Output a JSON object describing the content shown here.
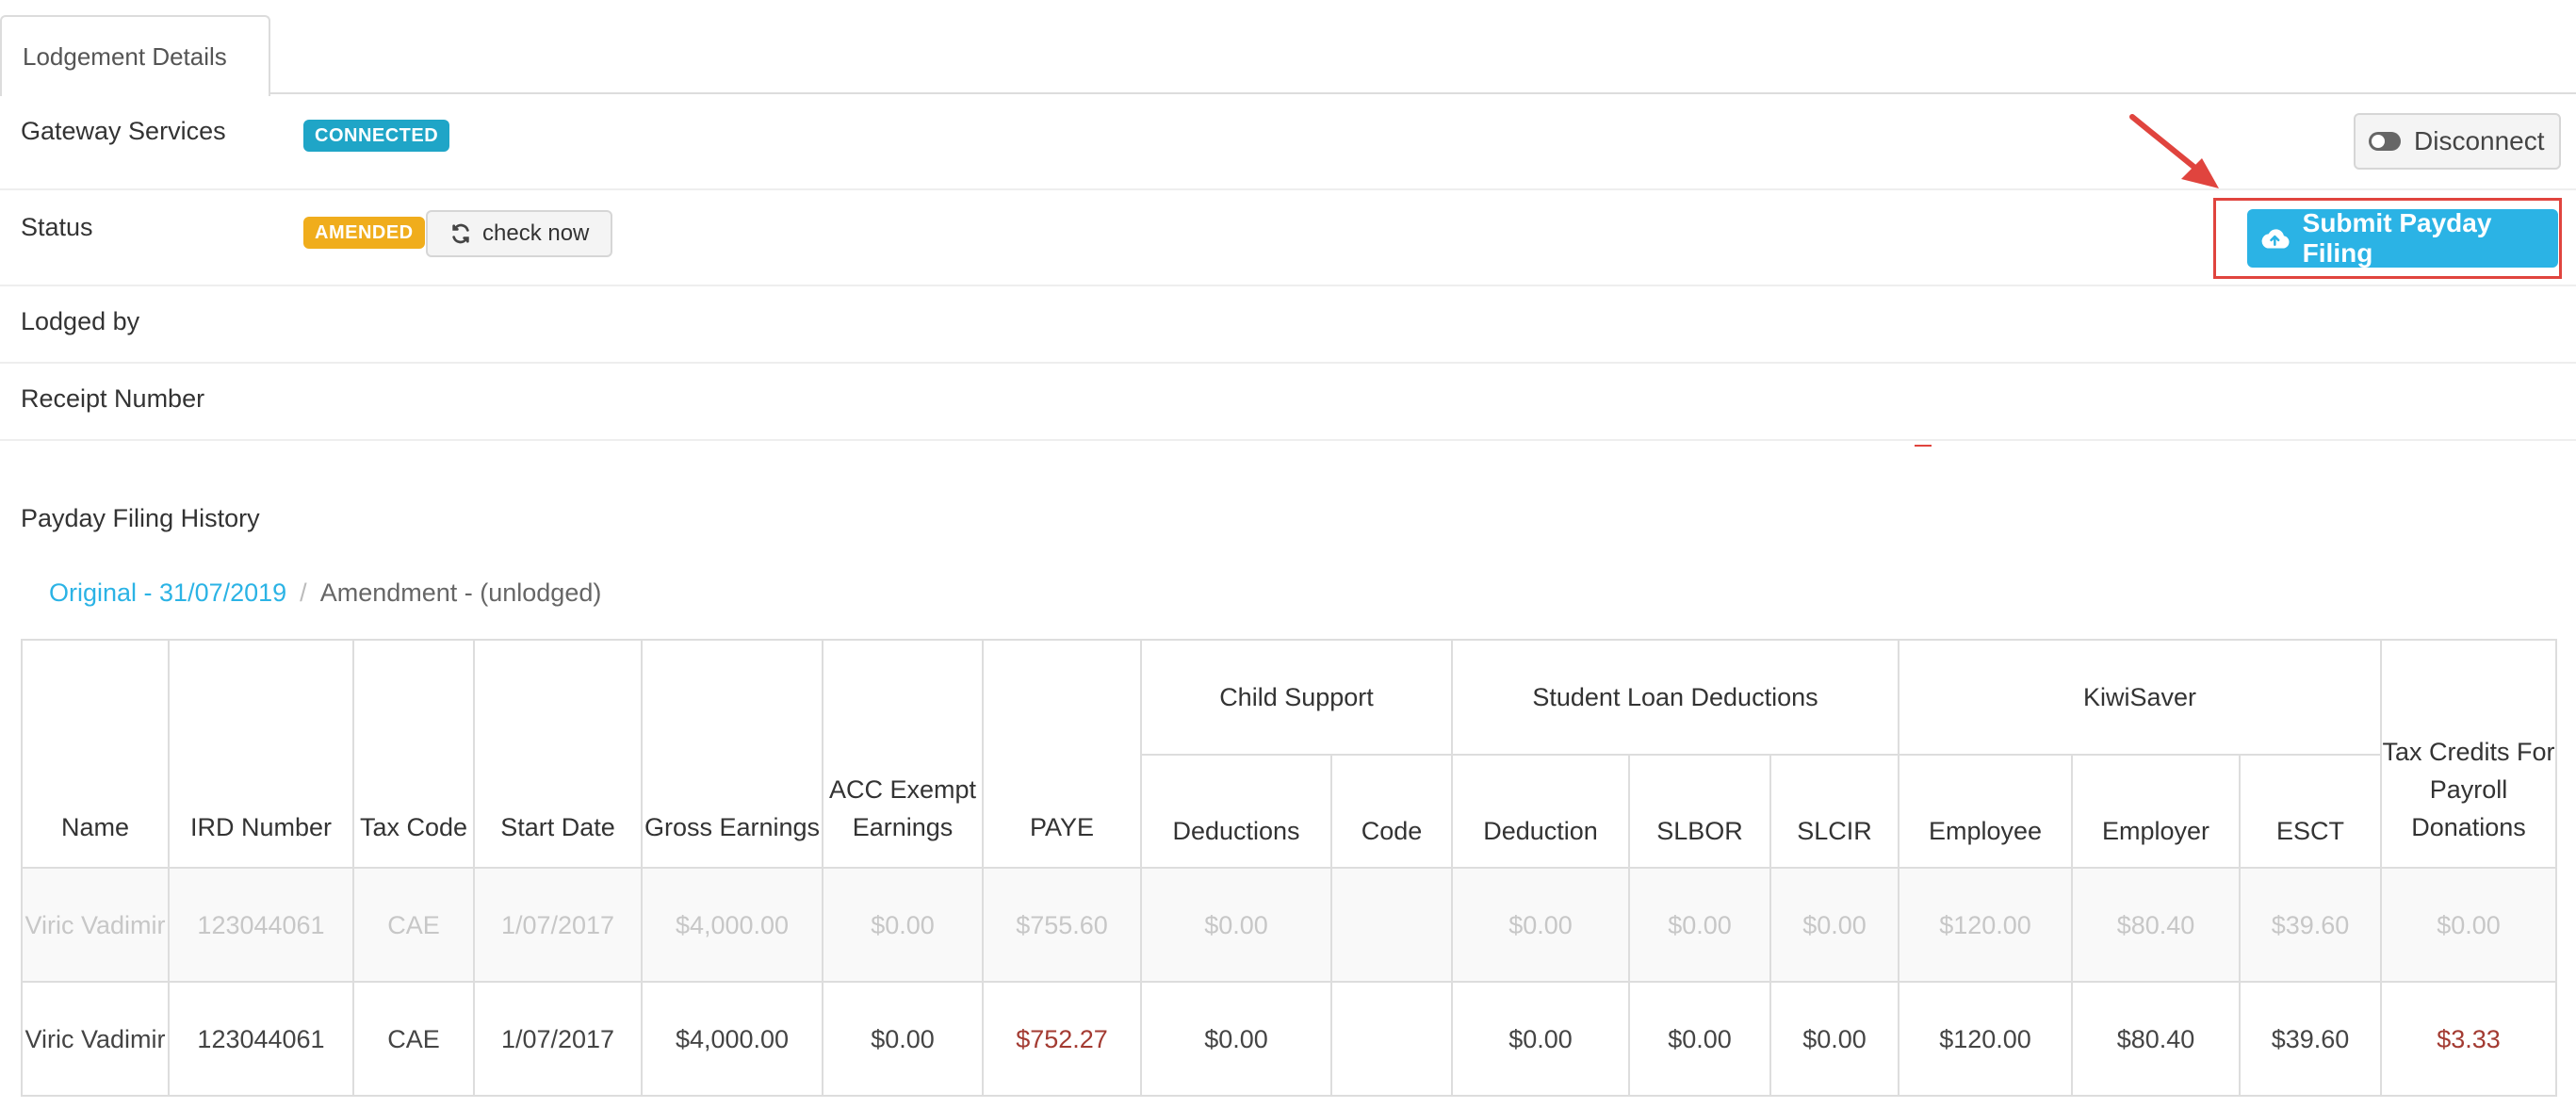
{
  "tab": {
    "label": "Lodgement Details"
  },
  "details": {
    "gateway_label": "Gateway Services",
    "gateway_status": "CONNECTED",
    "status_label": "Status",
    "status_value": "AMENDED",
    "check_now_label": "check now",
    "lodged_by_label": "Lodged by",
    "receipt_label": "Receipt Number",
    "disconnect_label": "Disconnect",
    "submit_label": "Submit Payday Filing"
  },
  "history": {
    "title": "Payday Filing History",
    "breadcrumb": {
      "original": "Original - 31/07/2019",
      "separator": "/",
      "amendment": "Amendment - (unlodged)"
    }
  },
  "table": {
    "headers": {
      "name": "Name",
      "ird_number": "IRD Number",
      "tax_code": "Tax Code",
      "start_date": "Start Date",
      "gross_earnings": "Gross Earnings",
      "acc_exempt": "ACC Exempt Earnings",
      "paye": "PAYE",
      "child_support": "Child Support",
      "cs_deductions": "Deductions",
      "cs_code": "Code",
      "student_loan": "Student Loan Deductions",
      "sl_deduction": "Deduction",
      "sl_slbor": "SLBOR",
      "sl_slcir": "SLCIR",
      "kiwisaver": "KiwiSaver",
      "ks_employee": "Employee",
      "ks_employer": "Employer",
      "ks_esct": "ESCT",
      "tax_credits": "Tax Credits For Payroll Donations"
    },
    "rows": [
      {
        "name": "Viric Vadimir",
        "ird_number": "123044061",
        "tax_code": "CAE",
        "start_date": "1/07/2017",
        "gross_earnings": "$4,000.00",
        "acc_exempt": "$0.00",
        "paye": "$755.60",
        "cs_deductions": "$0.00",
        "cs_code": "",
        "sl_deduction": "$0.00",
        "sl_slbor": "$0.00",
        "sl_slcir": "$0.00",
        "ks_employee": "$120.00",
        "ks_employer": "$80.40",
        "ks_esct": "$39.60",
        "tax_credits": "$0.00"
      },
      {
        "name": "Viric Vadimir",
        "ird_number": "123044061",
        "tax_code": "CAE",
        "start_date": "1/07/2017",
        "gross_earnings": "$4,000.00",
        "acc_exempt": "$0.00",
        "paye": "$752.27",
        "cs_deductions": "$0.00",
        "cs_code": "",
        "sl_deduction": "$0.00",
        "sl_slbor": "$0.00",
        "sl_slcir": "$0.00",
        "ks_employee": "$120.00",
        "ks_employer": "$80.40",
        "ks_esct": "$39.60",
        "tax_credits": "$3.33"
      }
    ]
  },
  "colors": {
    "connected_badge": "#1fa5c7",
    "amended_badge": "#f0ad1c",
    "submit_button": "#2bb3e5",
    "highlight": "#e0443e",
    "changed_value": "#a33b32",
    "link": "#2bb3e5"
  },
  "icons": {
    "check_now": "refresh-icon",
    "disconnect": "toggle-icon",
    "submit": "cloud-upload-icon",
    "annotation": "arrow-icon"
  }
}
